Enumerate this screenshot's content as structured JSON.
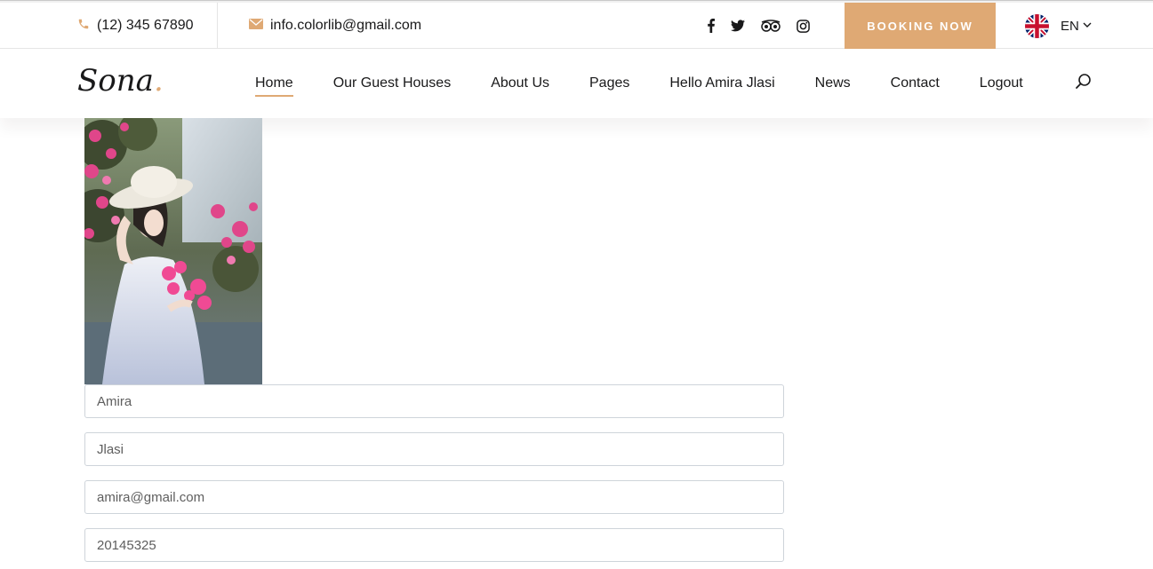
{
  "topbar": {
    "phone": "(12) 345 67890",
    "phone_icon": "phone-icon",
    "email": "info.colorlib@gmail.com",
    "email_icon": "envelope-icon",
    "social_icons": [
      "facebook-icon",
      "twitter-icon",
      "tripadvisor-icon",
      "instagram-icon"
    ],
    "booking_label": "BOOKING NOW",
    "language": "EN"
  },
  "header": {
    "logo_text": "Sona",
    "logo_dot": ".",
    "nav": [
      {
        "label": "Home",
        "active": true
      },
      {
        "label": "Our Guest Houses"
      },
      {
        "label": "About Us"
      },
      {
        "label": "Pages"
      },
      {
        "label": "Hello Amira Jlasi"
      },
      {
        "label": "News"
      },
      {
        "label": "Contact"
      },
      {
        "label": "Logout"
      }
    ]
  },
  "profile": {
    "first_name": "Amira",
    "last_name": "Jlasi",
    "email": "amira@gmail.com",
    "phone": "20145325"
  },
  "colors": {
    "accent": "#dfa974",
    "text": "#19191a",
    "border": "#ced4da"
  }
}
